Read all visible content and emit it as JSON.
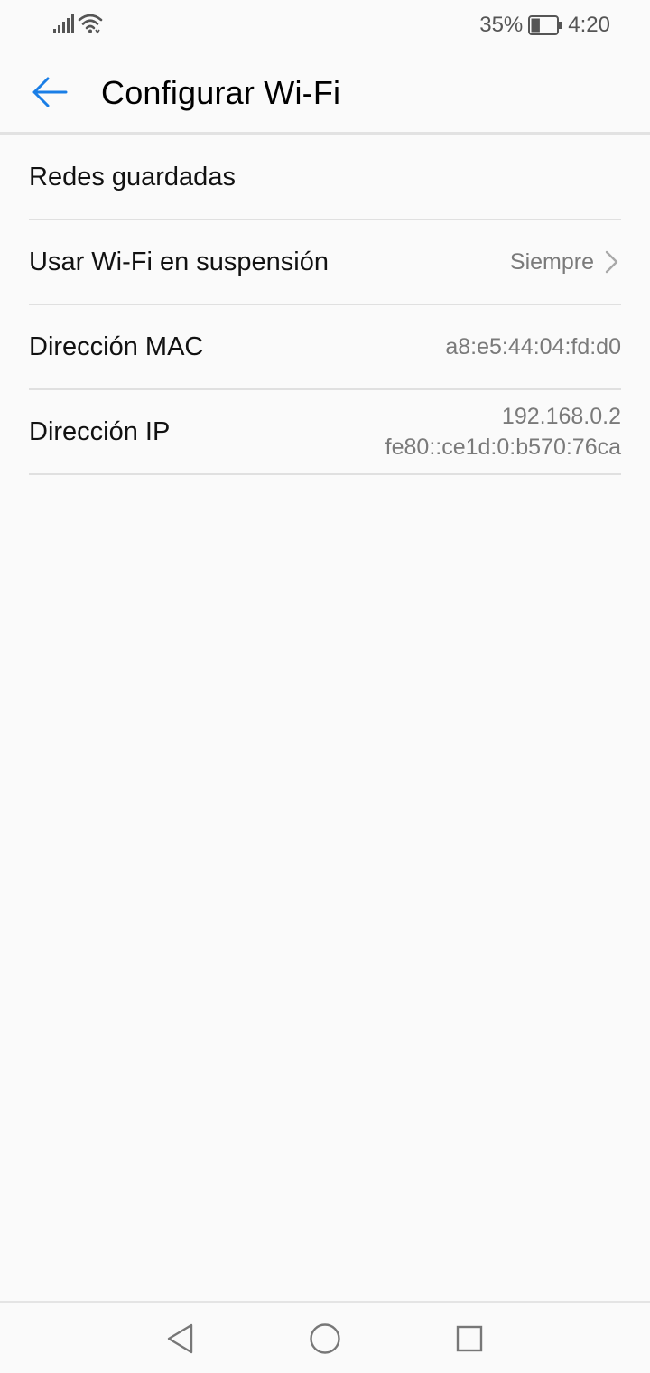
{
  "status_bar": {
    "battery_percent": "35%",
    "battery_level": 0.35,
    "time": "4:20",
    "icons": [
      "signal-icon",
      "wifi-icon",
      "battery-icon"
    ]
  },
  "app_bar": {
    "title": "Configurar Wi-Fi",
    "back_icon": "arrow-back-icon",
    "accent_color": "#1a7ee6"
  },
  "settings": {
    "saved_networks": {
      "label": "Redes guardadas"
    },
    "sleep_policy": {
      "label": "Usar Wi-Fi en suspensión",
      "value": "Siempre"
    },
    "mac_address": {
      "label": "Dirección MAC",
      "value": "a8:e5:44:04:fd:d0"
    },
    "ip_address": {
      "label": "Dirección IP",
      "value_ipv4": "192.168.0.2",
      "value_ipv6": "fe80::ce1d:0:b570:76ca"
    }
  },
  "nav_bar": {
    "icons": [
      "back-triangle-icon",
      "home-circle-icon",
      "recents-square-icon"
    ]
  }
}
